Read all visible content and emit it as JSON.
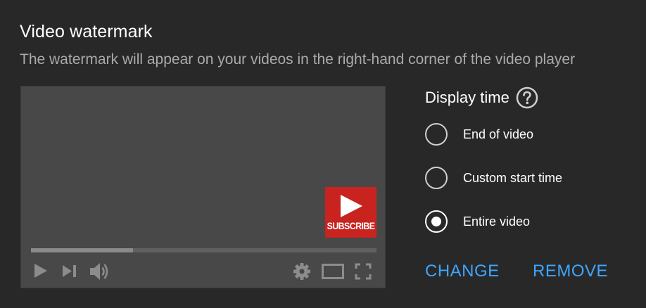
{
  "header": {
    "title": "Video watermark",
    "subtitle": "The watermark will appear on your videos in the right-hand corner of the video player"
  },
  "player": {
    "watermark_label": "SUBSCRIBE",
    "progress": 0.295,
    "controls": [
      "play-icon",
      "skip-next-icon",
      "volume-icon",
      "gear-icon",
      "theater-mode-icon",
      "fullscreen-icon"
    ]
  },
  "display_time": {
    "label": "Display time",
    "help_icon": "help-circle-icon",
    "options": [
      {
        "label": "End of video",
        "selected": false
      },
      {
        "label": "Custom start time",
        "selected": false
      },
      {
        "label": "Entire video",
        "selected": true
      }
    ]
  },
  "actions": {
    "change_label": "CHANGE",
    "remove_label": "REMOVE"
  },
  "colors": {
    "background": "#282828",
    "player_bg": "#484848",
    "accent": "#3ea6ff",
    "watermark_red": "#c8231f",
    "muted_text": "#aaaaaa"
  }
}
